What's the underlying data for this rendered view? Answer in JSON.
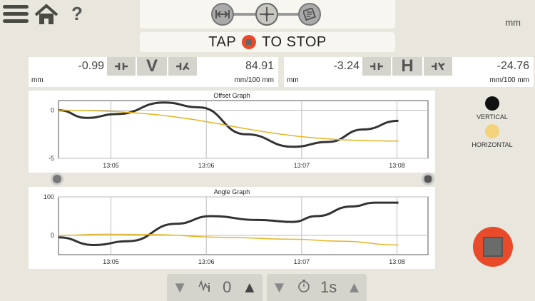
{
  "header": {
    "help_label": "?",
    "unit": "mm"
  },
  "banner": {
    "prefix": "TAP",
    "suffix": "TO STOP"
  },
  "vertical": {
    "left_value": "-0.99",
    "right_value": "84.91",
    "letter": "V",
    "left_unit": "mm",
    "right_unit": "mm/100 mm"
  },
  "horizontal": {
    "left_value": "-3.24",
    "right_value": "-24.76",
    "letter": "H",
    "left_unit": "mm",
    "right_unit": "mm/100 mm"
  },
  "legend": {
    "vertical": {
      "label": "VERTICAL",
      "color": "#111111"
    },
    "horizontal": {
      "label": "HORIZONTAL",
      "color": "#f2d27a"
    }
  },
  "bottom": {
    "filter_value": "0",
    "interval_value": "1s"
  },
  "chart_data": [
    {
      "type": "line",
      "title": "Offset Graph",
      "x_ticks": [
        "13:05",
        "13:06",
        "13:07",
        "13:08"
      ],
      "y_ticks": [
        "0",
        "-5"
      ],
      "ylim": [
        -5,
        1
      ],
      "series": [
        {
          "name": "Vertical",
          "color": "#333333",
          "points": [
            [
              0,
              0
            ],
            [
              0.12,
              -0.8
            ],
            [
              0.25,
              -0.4
            ],
            [
              0.45,
              0.8
            ],
            [
              0.6,
              0.3
            ],
            [
              0.8,
              -2.5
            ],
            [
              1.0,
              -3.8
            ],
            [
              1.15,
              -3.3
            ],
            [
              1.3,
              -2
            ],
            [
              1.45,
              -1.1
            ]
          ]
        },
        {
          "name": "Horizontal",
          "color": "#e6b422",
          "points": [
            [
              0,
              0
            ],
            [
              1.45,
              -3.2
            ]
          ]
        }
      ]
    },
    {
      "type": "line",
      "title": "Angle Graph",
      "x_ticks": [
        "13:05",
        "13:06",
        "13:07",
        "13:08"
      ],
      "y_ticks": [
        "100",
        "0"
      ],
      "ylim": [
        -50,
        100
      ],
      "series": [
        {
          "name": "Vertical",
          "color": "#333333",
          "points": [
            [
              0,
              -5
            ],
            [
              0.15,
              -25
            ],
            [
              0.3,
              -15
            ],
            [
              0.5,
              30
            ],
            [
              0.65,
              50
            ],
            [
              0.85,
              40
            ],
            [
              1.0,
              35
            ],
            [
              1.1,
              50
            ],
            [
              1.25,
              75
            ],
            [
              1.35,
              85
            ],
            [
              1.45,
              85
            ]
          ]
        },
        {
          "name": "Horizontal",
          "color": "#e6b422",
          "points": [
            [
              0,
              0
            ],
            [
              0.2,
              3
            ],
            [
              0.4,
              2
            ],
            [
              0.7,
              -5
            ],
            [
              1.0,
              -10
            ],
            [
              1.2,
              -15
            ],
            [
              1.45,
              -25
            ]
          ]
        }
      ]
    }
  ]
}
